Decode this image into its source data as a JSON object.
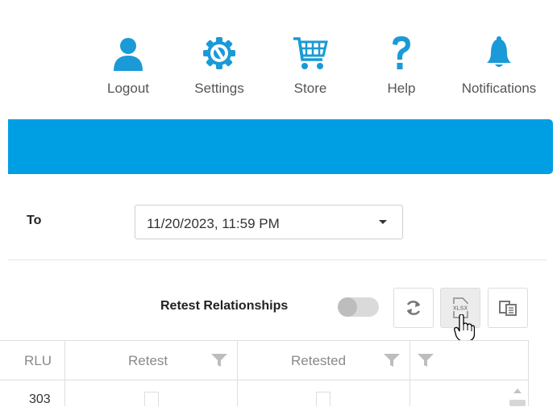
{
  "nav": {
    "items": [
      {
        "label": "Logout",
        "icon": "user-icon"
      },
      {
        "label": "Settings",
        "icon": "gear-icon"
      },
      {
        "label": "Store",
        "icon": "cart-icon"
      },
      {
        "label": "Help",
        "icon": "question-icon"
      },
      {
        "label": "Notifications",
        "icon": "bell-icon"
      }
    ]
  },
  "colors": {
    "accent": "#009fe3",
    "nav_icon": "#1a9ad6"
  },
  "filter": {
    "to_label": "To",
    "to_value": "11/20/2023, 11:59 PM"
  },
  "toolbar": {
    "retest_relationships_label": "Retest Relationships",
    "retest_relationships_on": false,
    "buttons": [
      "refresh-icon",
      "xlsx-export-icon",
      "column-chooser-icon"
    ],
    "xlsx_label": "XLSX"
  },
  "grid": {
    "columns": [
      {
        "header": "RLU",
        "filter": false
      },
      {
        "header": "Retest",
        "filter": true
      },
      {
        "header": "Retested",
        "filter": true
      },
      {
        "header": "",
        "filter": true
      }
    ],
    "rows": [
      {
        "rlu": "303",
        "retest": false,
        "retested": false
      }
    ]
  }
}
